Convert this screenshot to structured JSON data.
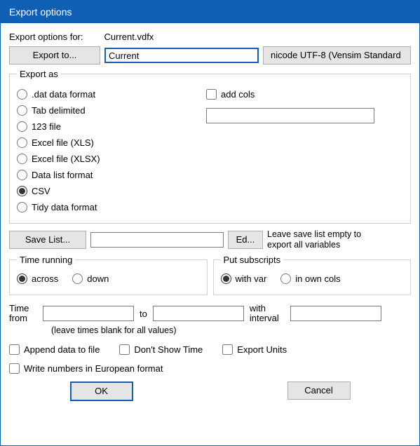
{
  "titlebar": "Export options",
  "header": {
    "options_for_label": "Export options for:",
    "filename": "Current.vdfx",
    "export_to_label": "Export to...",
    "name_input": "Current",
    "encoding_display": "nicode UTF-8 (Vensim Standard"
  },
  "export_as": {
    "legend": "Export as",
    "formats": {
      "dat": ".dat data format",
      "tab": "Tab delimited",
      "wks": "123 file",
      "xls": "Excel file (XLS)",
      "xlsx": "Excel file (XLSX)",
      "datalist": "Data list format",
      "csv": "CSV",
      "tidy": "Tidy data format"
    },
    "selected": "csv",
    "add_cols_label": "add cols",
    "add_cols_input": ""
  },
  "save_list": {
    "button": "Save List...",
    "value": "",
    "edit_button": "Ed...",
    "note": "Leave save list empty to export all variables"
  },
  "time_running": {
    "legend": "Time running",
    "across": "across",
    "down": "down",
    "selected": "across"
  },
  "subscripts": {
    "legend": "Put subscripts",
    "with_var": "with var",
    "own_cols": "in own cols",
    "selected": "with_var"
  },
  "time_range": {
    "from_label": "Time from",
    "to_label": "to",
    "interval_label": "with interval",
    "from": "",
    "to": "",
    "interval": "",
    "hint": "(leave times blank for all values)"
  },
  "options": {
    "append": "Append data to file",
    "dont_show_time": "Don't Show Time",
    "export_units": "Export Units",
    "european": "Write numbers in European format"
  },
  "buttons": {
    "ok": "OK",
    "cancel": "Cancel"
  }
}
